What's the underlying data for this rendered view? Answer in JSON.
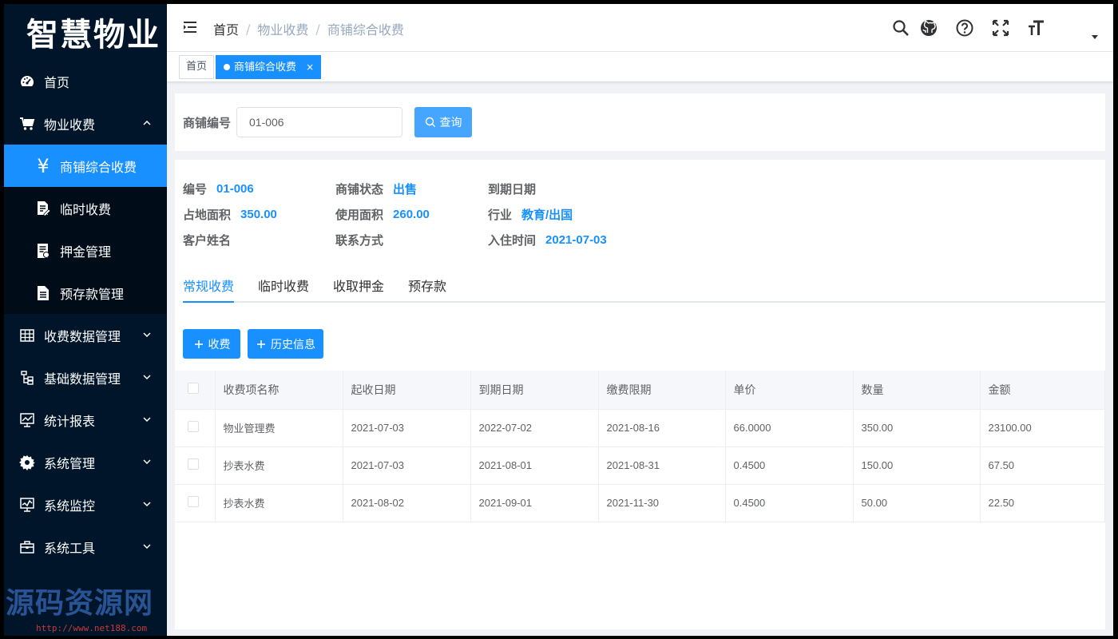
{
  "app": {
    "logo_text": "智慧物业"
  },
  "sidebar": {
    "items": [
      {
        "label": "首页",
        "icon": "dashboard-icon"
      },
      {
        "label": "物业收费",
        "icon": "cart-icon",
        "expanded": true
      },
      {
        "label": "商铺综合收费",
        "icon": "yen-icon",
        "active": true
      },
      {
        "label": "临时收费",
        "icon": "edit-doc-icon"
      },
      {
        "label": "押金管理",
        "icon": "receipt-icon"
      },
      {
        "label": "预存款管理",
        "icon": "document-icon"
      },
      {
        "label": "收费数据管理",
        "icon": "table-icon"
      },
      {
        "label": "基础数据管理",
        "icon": "tree-icon"
      },
      {
        "label": "统计报表",
        "icon": "chart-icon"
      },
      {
        "label": "系统管理",
        "icon": "gear-icon"
      },
      {
        "label": "系统监控",
        "icon": "monitor-icon"
      },
      {
        "label": "系统工具",
        "icon": "toolbox-icon"
      }
    ],
    "watermark": "源码资源网",
    "watermark_url": "http://www.net188.com"
  },
  "header": {
    "breadcrumb": [
      "首页",
      "物业收费",
      "商铺综合收费"
    ],
    "icons": [
      "search-icon",
      "github-icon",
      "help-icon",
      "fullscreen-icon",
      "font-size-icon"
    ]
  },
  "tags": [
    {
      "label": "首页",
      "active": false
    },
    {
      "label": "商铺综合收费",
      "active": true,
      "close": "×"
    }
  ],
  "search": {
    "label": "商铺编号",
    "value": "01-006",
    "button_label": "查询"
  },
  "shop_info": {
    "code_label": "编号",
    "code": "01-006",
    "status_label": "商铺状态",
    "status": "出售",
    "expire_label": "到期日期",
    "expire": "",
    "area_label": "占地面积",
    "area": "350.00",
    "use_area_label": "使用面积",
    "use_area": "260.00",
    "industry_label": "行业",
    "industry": "教育/出国",
    "customer_label": "客户姓名",
    "customer": "",
    "contact_label": "联系方式",
    "contact": "",
    "checkin_label": "入住时间",
    "checkin": "2021-07-03"
  },
  "tabs": [
    {
      "label": "常规收费",
      "active": true
    },
    {
      "label": "临时收费"
    },
    {
      "label": "收取押金"
    },
    {
      "label": "预存款"
    }
  ],
  "actions": {
    "add_label": "收费",
    "history_label": "历史信息"
  },
  "table": {
    "columns": [
      "收费项名称",
      "起收日期",
      "到期日期",
      "缴费限期",
      "单价",
      "数量",
      "金额"
    ],
    "rows": [
      [
        "物业管理费",
        "2021-07-03",
        "2022-07-02",
        "2021-08-16",
        "66.0000",
        "350.00",
        "23100.00"
      ],
      [
        "抄表水费",
        "2021-07-03",
        "2021-08-01",
        "2021-08-31",
        "0.4500",
        "150.00",
        "67.50"
      ],
      [
        "抄表水费",
        "2021-08-02",
        "2021-09-01",
        "2021-11-30",
        "0.4500",
        "50.00",
        "22.50"
      ]
    ]
  },
  "colors": {
    "primary": "#1890ff",
    "sidebar_bg": "#001529",
    "submenu_bg": "#000c17"
  }
}
